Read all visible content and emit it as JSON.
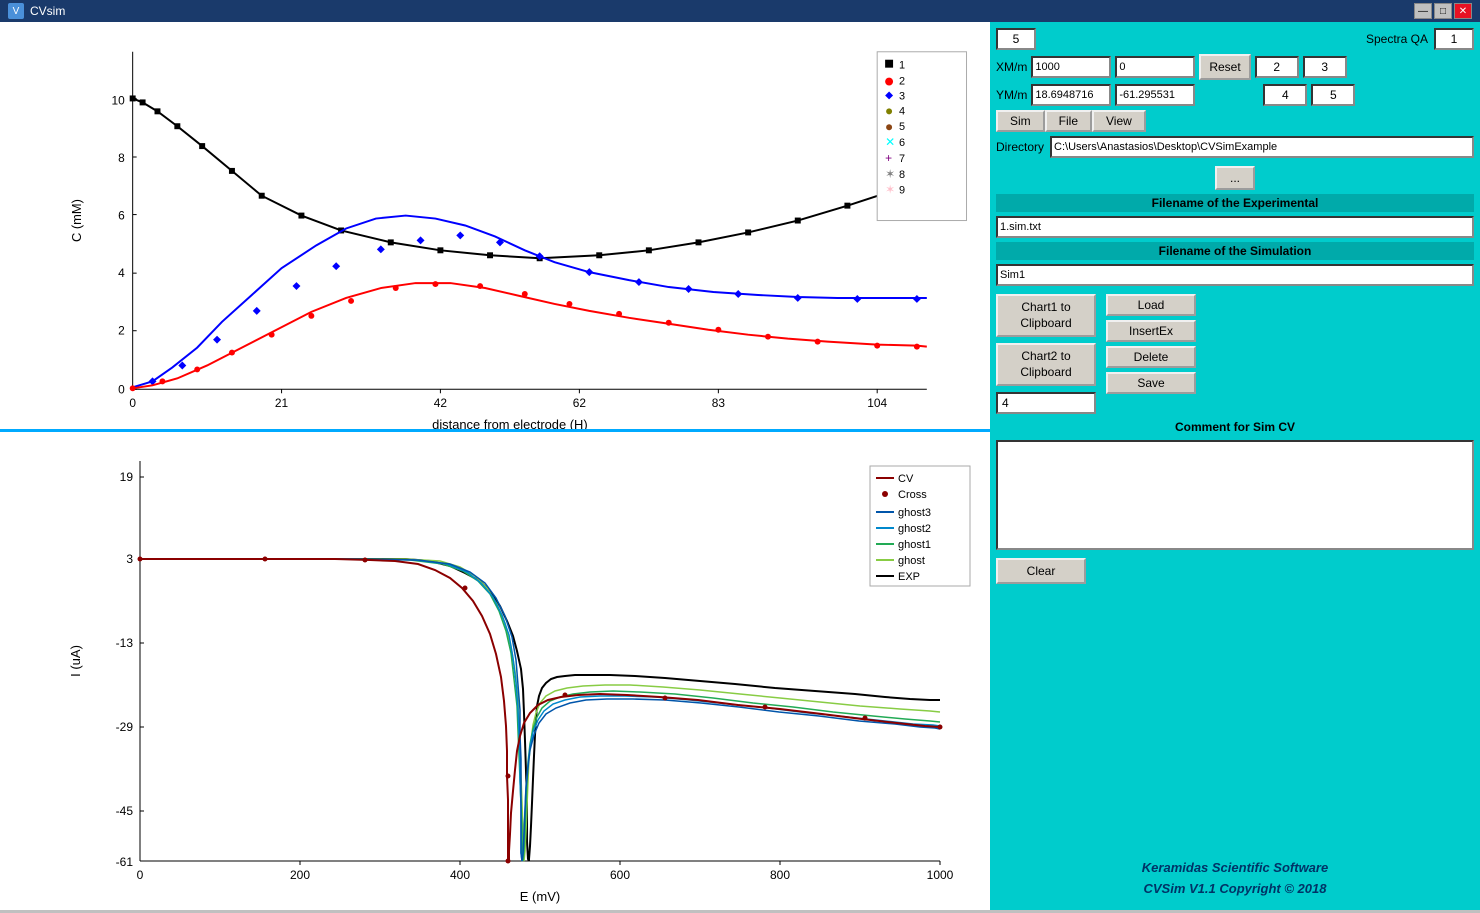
{
  "titleBar": {
    "icon": "V",
    "title": "CVsim",
    "minBtn": "—",
    "maxBtn": "□",
    "closeBtn": "✕"
  },
  "rightPanel": {
    "spectraLabel": "Spectra QA",
    "spectraInput": "5",
    "spectraQAValue": "1",
    "xmLabel": "XM/m",
    "xmValue": "1000",
    "xmValue2": "0",
    "ymLabel": "YM/m",
    "ymValue": "18.6948716",
    "ymValue2": "-61.295531",
    "resetBtn": "Reset",
    "num2": "2",
    "num3": "3",
    "num4": "4",
    "num5": "5",
    "menuSim": "Sim",
    "menuFile": "File",
    "menuView": "View",
    "directoryLabel": "Directory",
    "directoryPath": "C:\\Users\\Anastasios\\Desktop\\CVSimExample",
    "browseBtn": "...",
    "experimentalHeader": "Filename of the Experimental",
    "experimentalFilename": "1.sim.txt",
    "simulationHeader": "Filename of the Simulation",
    "simulationFilename": "Sim1",
    "chart1Btn": "Chart1 to\nClipboard",
    "chart2Btn": "Chart2 to\nClipboard",
    "loadBtn": "Load",
    "insertExBtn": "InsertEx",
    "deleteBtn": "Delete",
    "saveBtn": "Save",
    "numValue": "4",
    "commentHeader": "Comment for Sim CV",
    "commentText": "",
    "clearBtn": "Clear",
    "footerLine1": "Keramidas Scientific Software",
    "footerLine2": "CVSim V1.1 Copyright © 2018"
  },
  "chart1": {
    "xAxisLabel": "distance from electrode (H)",
    "yAxisLabel": "C (mM)",
    "xTicks": [
      "0",
      "21",
      "42",
      "62",
      "83",
      "104"
    ],
    "yTicks": [
      "0",
      "2",
      "4",
      "6",
      "8",
      "10"
    ],
    "legendItems": [
      {
        "num": "1",
        "color": "black",
        "marker": "square"
      },
      {
        "num": "2",
        "color": "red",
        "marker": "dot"
      },
      {
        "num": "3",
        "color": "blue",
        "marker": "diamond"
      },
      {
        "num": "4",
        "color": "olive",
        "marker": "dot"
      },
      {
        "num": "5",
        "color": "brown",
        "marker": "dot"
      },
      {
        "num": "6",
        "color": "cyan",
        "marker": "cross"
      },
      {
        "num": "7",
        "color": "purple",
        "marker": "plus"
      },
      {
        "num": "8",
        "color": "gray",
        "marker": "star"
      },
      {
        "num": "9",
        "color": "pink",
        "marker": "star"
      }
    ]
  },
  "chart2": {
    "xAxisLabel": "E (mV)",
    "yAxisLabel": "I (uA)",
    "xTicks": [
      "0",
      "200",
      "400",
      "600",
      "800",
      "1000"
    ],
    "yTicks": [
      "-61",
      "-45",
      "-29",
      "-13",
      "3",
      "19"
    ],
    "legendItems": [
      {
        "label": "CV",
        "color": "darkred"
      },
      {
        "label": "Cross",
        "color": "darkred"
      },
      {
        "label": "ghost3",
        "color": "#0055aa"
      },
      {
        "label": "ghost2",
        "color": "#0088cc"
      },
      {
        "label": "ghost1",
        "color": "#22aa55"
      },
      {
        "label": "ghost",
        "color": "#88cc44"
      },
      {
        "label": "EXP",
        "color": "black"
      }
    ]
  }
}
